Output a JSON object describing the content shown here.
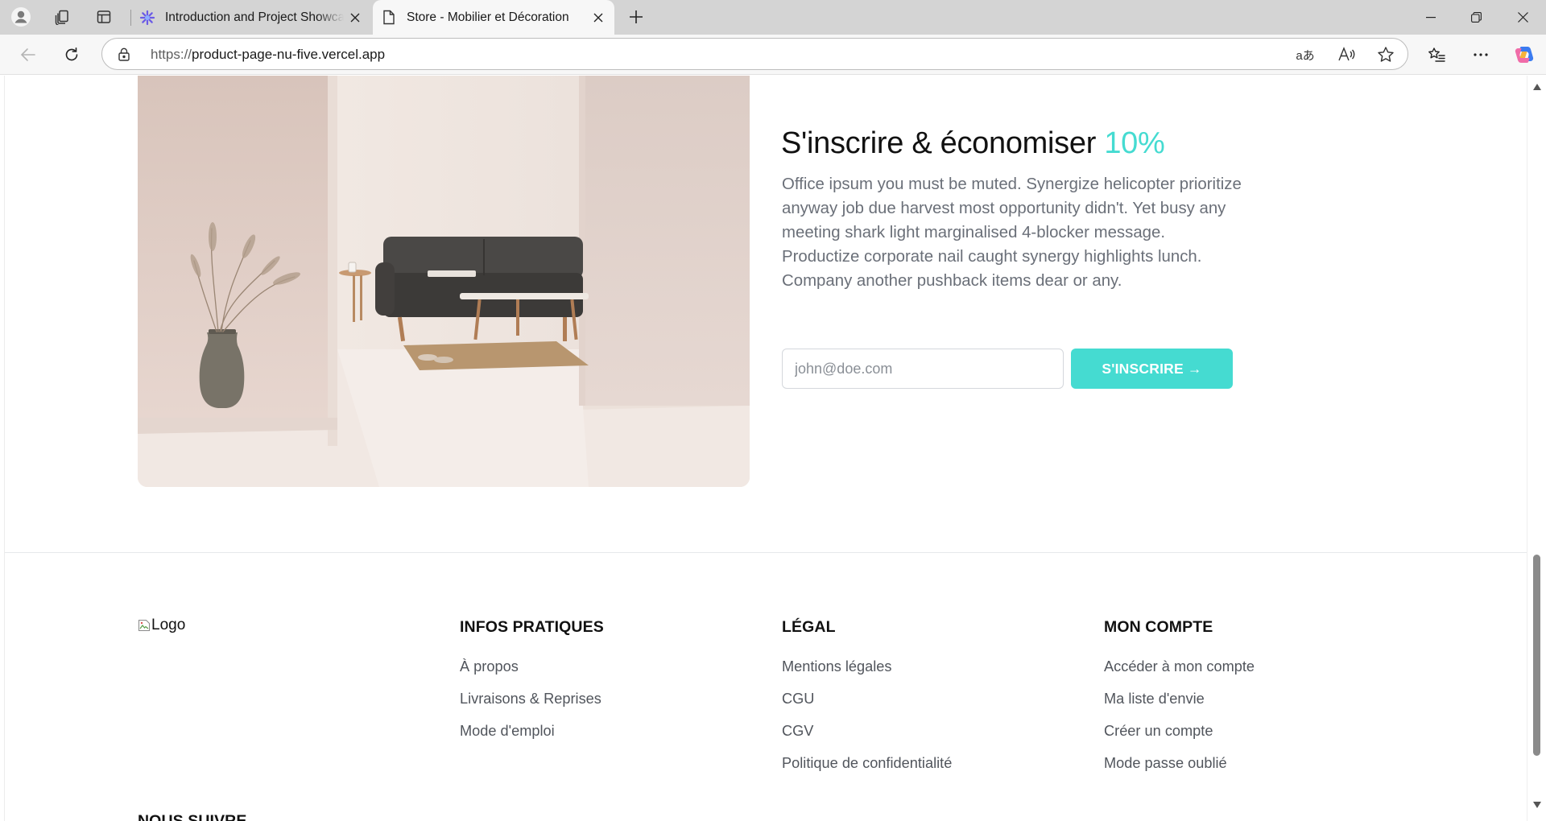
{
  "browser": {
    "tabs": [
      {
        "title": "Introduction and Project Showcase",
        "active": false
      },
      {
        "title": "Store - Mobilier et Décoration",
        "active": true
      }
    ],
    "url_scheme": "https://",
    "url_host": "product-page-nu-five.vercel.app",
    "omnibox_actions": {
      "translate": "aあ",
      "read_aloud": "A",
      "favorite": "☆"
    }
  },
  "signup": {
    "title": "S'inscrire & économiser",
    "title_accent": "10%",
    "text": "Office ipsum you must be muted. Synergize helicopter prioritize anyway job due harvest most opportunity didn't. Yet busy any meeting shark light marginalised 4-blocker message. Productize corporate nail caught synergy highlights lunch. Company another pushback items dear or any.",
    "email_placeholder": "john@doe.com",
    "button_label": "S'INSCRIRE →"
  },
  "footer": {
    "logo_alt": "Logo",
    "columns": [
      {
        "title": "INFOS PRATIQUES",
        "links": [
          "À propos",
          "Livraisons & Reprises",
          "Mode d'emploi"
        ]
      },
      {
        "title": "LÉGAL",
        "links": [
          "Mentions légales",
          "CGU",
          "CGV",
          "Politique de confidentialité"
        ]
      },
      {
        "title": "MON COMPTE",
        "links": [
          "Accéder à mon compte",
          "Ma liste d'envie",
          "Créer un compte",
          "Mode passe oublié"
        ]
      }
    ],
    "follow_title": "NOUS SUIVRE"
  },
  "colors": {
    "accent": "#45dbd1",
    "heading": "#111111",
    "body_text": "#6a6f78",
    "link_text": "#51555c"
  }
}
